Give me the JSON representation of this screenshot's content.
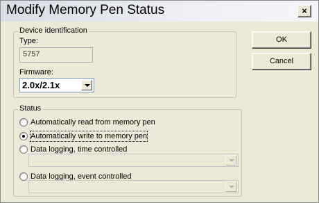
{
  "window": {
    "title": "Modify Memory Pen Status",
    "close_glyph": "×"
  },
  "device": {
    "group_label": "Device identification",
    "type_label": "Type:",
    "type_value": "5757",
    "firmware_label": "Firmware:",
    "firmware_value": "2.0x/2.1x"
  },
  "status": {
    "group_label": "Status",
    "options": [
      {
        "label": "Automatically read from memory pen",
        "checked": false
      },
      {
        "label": "Automatically write to memory pen",
        "checked": true
      },
      {
        "label": "Data logging, time controlled",
        "checked": false
      },
      {
        "label": "Data logging, event controlled",
        "checked": false
      }
    ]
  },
  "buttons": {
    "ok": "OK",
    "cancel": "Cancel"
  },
  "icons": {
    "close": "close-icon",
    "dropdown": "chevron-down-icon"
  }
}
